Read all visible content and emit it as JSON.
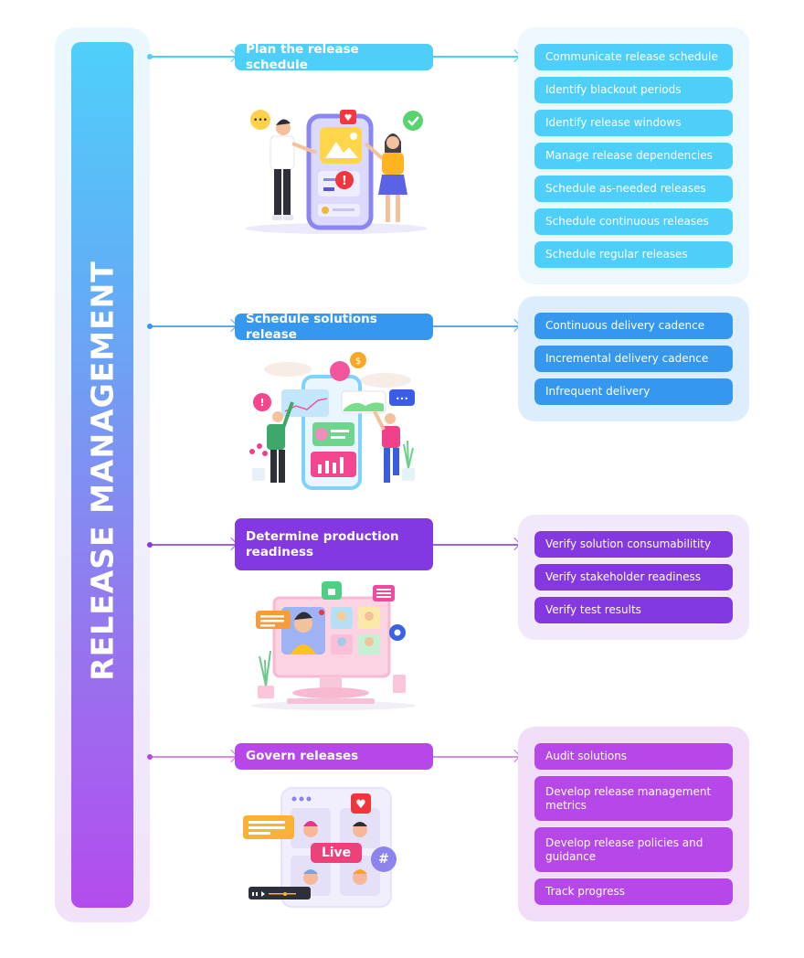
{
  "title": "RELEASE MANAGEMENT",
  "colors": {
    "cyan": "#4dcffa",
    "blue": "#3598ee",
    "violet": "#8338e1",
    "purple": "#b648e9",
    "panel_cyan": "#ecf8fe",
    "panel_blue": "#dceefd",
    "panel_violet": "#f1e8fc",
    "panel_purple": "#f1ddf8"
  },
  "sections": [
    {
      "step": "Plan the release schedule",
      "illustration": "mobile-app-team-illustration",
      "tasks": [
        "Communicate release schedule",
        "Identify blackout periods",
        "Identify release windows",
        "Manage release dependencies",
        "Schedule as-needed releases",
        "Schedule continuous releases",
        "Schedule regular releases"
      ]
    },
    {
      "step": "Schedule solutions release",
      "illustration": "analytics-dashboard-illustration",
      "tasks": [
        "Continuous delivery cadence",
        "Incremental delivery cadence",
        "Infrequent delivery"
      ]
    },
    {
      "step": "Determine production readiness",
      "illustration": "video-conference-monitor-illustration",
      "tasks": [
        "Verify solution consumabilitity",
        "Verify stakeholder readiness",
        "Verify test results"
      ]
    },
    {
      "step": "Govern releases",
      "illustration": "live-stream-illustration",
      "live_label": "Live",
      "hash_label": "#",
      "tasks": [
        "Audit solutions",
        "Develop release management metrics",
        "Develop release policies and guidance",
        "Track progress"
      ]
    }
  ]
}
